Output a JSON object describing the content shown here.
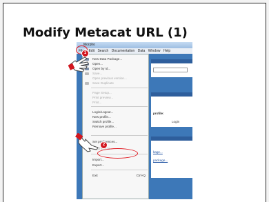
{
  "slide": {
    "title": "Modify Metacat URL (1)"
  },
  "window": {
    "title": "Morpho"
  },
  "menubar": [
    "File",
    "Edit",
    "Search",
    "Documentation",
    "Data",
    "Window",
    "Help"
  ],
  "menu": {
    "new_package": "New Data Package...",
    "open": "Open...",
    "open_by_id": "Open by Id...",
    "save": "Save...",
    "open_prev": "Open previous version...",
    "save_dup": "Save Duplicate",
    "page_setup": "Page Setup...",
    "print_preview": "Print preview...",
    "print": "Print...",
    "login": "Login/Logout...",
    "new_profile": "New profile...",
    "switch_profile": "Switch profile...",
    "remove_profile": "Remove profile...",
    "set_prefs": "Set preferences...",
    "synchronize": "Synchronize...",
    "import": "Import...",
    "export": "Export...",
    "exit": "Exit",
    "exit_shortcut": "Ctrl+Q"
  },
  "panels": {
    "profile_label": "profile:",
    "login_button": "Login",
    "link1": "kage...",
    "link2": "package..."
  },
  "callouts": {
    "step1": "1",
    "step2": "2"
  },
  "colors": {
    "accent": "#d2161e",
    "desktop": "#3d78b8"
  }
}
